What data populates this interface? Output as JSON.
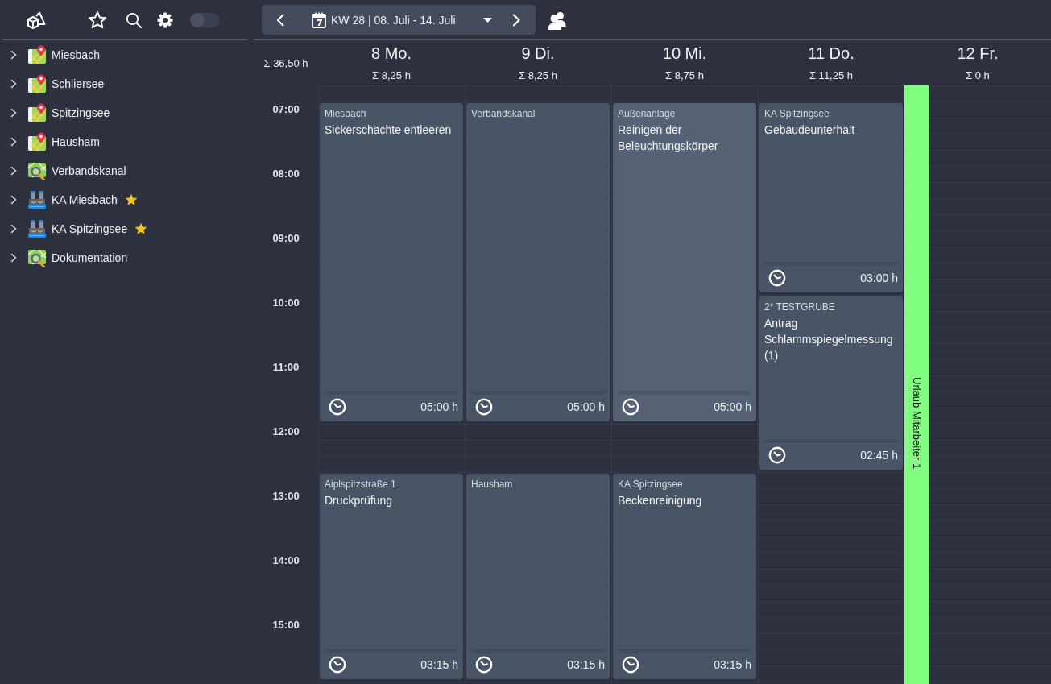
{
  "toolbar": {
    "toggle": {
      "on": false
    }
  },
  "sidebar": {
    "items": [
      {
        "label": "Miesbach",
        "kind": "location",
        "expanded": false,
        "favorite": false
      },
      {
        "label": "Schliersee",
        "kind": "location",
        "expanded": false,
        "favorite": false
      },
      {
        "label": "Spitzingsee",
        "kind": "location",
        "expanded": false,
        "favorite": false
      },
      {
        "label": "Hausham",
        "kind": "location",
        "expanded": false,
        "favorite": false
      },
      {
        "label": "Verbandskanal",
        "kind": "survey",
        "expanded": false,
        "favorite": false
      },
      {
        "label": "KA Miesbach",
        "kind": "plant",
        "expanded": false,
        "favorite": true
      },
      {
        "label": "KA Spitzingsee",
        "kind": "plant",
        "expanded": false,
        "favorite": true
      },
      {
        "label": "Dokumentation",
        "kind": "survey",
        "expanded": false,
        "favorite": false
      }
    ]
  },
  "week_nav": {
    "label": "KW 28 | 08. Juli - 14. Juli"
  },
  "calendar": {
    "week_total": "Σ 36,50 h",
    "hours": [
      "07:00",
      "08:00",
      "09:00",
      "10:00",
      "11:00",
      "12:00",
      "13:00",
      "14:00",
      "15:00"
    ],
    "days": [
      {
        "label": "8 Mo.",
        "total": "Σ 8,25 h",
        "blocks": [
          {
            "events": [
              {
                "place": "Miesbach",
                "title": "Sickerschächte entleeren",
                "duration": "05:00 h",
                "highlighted": false
              }
            ]
          },
          {
            "events": [
              {
                "place": "Aiplspitzstraße 1",
                "title": "Druckprüfung",
                "duration": "03:15 h",
                "highlighted": false
              }
            ]
          }
        ]
      },
      {
        "label": "9 Di.",
        "total": "Σ 8,25 h",
        "blocks": [
          {
            "events": [
              {
                "place": "Verbandskanal",
                "duration": "05:00 h",
                "highlighted": false
              }
            ]
          },
          {
            "events": [
              {
                "place": "Hausham",
                "duration": "03:15 h",
                "highlighted": false
              }
            ]
          }
        ]
      },
      {
        "label": "10 Mi.",
        "total": "Σ 8,75 h",
        "blocks": [
          {
            "events": [
              {
                "place": "Außenanlage",
                "title": "Reinigen der Beleuchtungskörper",
                "duration": "05:00 h",
                "highlighted": true
              }
            ]
          },
          {
            "events": [
              {
                "place": "KA Spitzingsee",
                "title": "Beckenreinigung",
                "duration": "03:15 h",
                "highlighted": false
              }
            ]
          }
        ]
      },
      {
        "label": "11 Do.",
        "total": "Σ 11,25 h",
        "blocks": [
          {
            "events": [
              {
                "place": "KA Spitzingsee",
                "title": "Gebäudeunterhalt",
                "duration": "03:00 h",
                "highlighted": false
              },
              {
                "place": "2* TESTGRUBE",
                "title": "Antrag Schlammspiegelmessung (1)",
                "duration": "02:45 h",
                "highlighted": false
              }
            ]
          }
        ]
      },
      {
        "label": "12 Fr.",
        "total": "Σ 0 h",
        "absence": {
          "label": "Urlaub Mitarbeiter 1"
        }
      }
    ]
  }
}
